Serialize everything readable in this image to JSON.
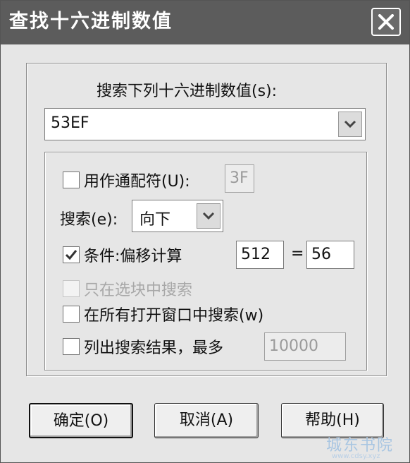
{
  "window": {
    "title": "查找十六进制数值",
    "close_icon": "close-icon"
  },
  "search_section": {
    "label": "搜索下列十六进制数值(s):",
    "value": "53EF",
    "arrow_icon": "chevron-down-icon"
  },
  "options": {
    "wildcard": {
      "label": "用作通配符(U):",
      "checked": false,
      "value": "3F"
    },
    "direction": {
      "label": "搜索(e):",
      "value": "向下"
    },
    "condition": {
      "label": "条件:偏移计算",
      "checked": true,
      "offset": "512",
      "equals": "=",
      "result": "56"
    },
    "selection_only": {
      "label": "只在选块中搜索",
      "checked": false,
      "enabled": false
    },
    "all_windows": {
      "label": "在所有打开窗口中搜索(w)",
      "checked": false
    },
    "list_results": {
      "label": "列出搜索结果，最多",
      "checked": false,
      "value": "10000"
    }
  },
  "buttons": {
    "ok": "确定(O)",
    "cancel": "取消(A)",
    "help": "帮助(H)"
  },
  "watermark": {
    "text": "城东书院",
    "sub": "www.cdsy.xyz"
  }
}
